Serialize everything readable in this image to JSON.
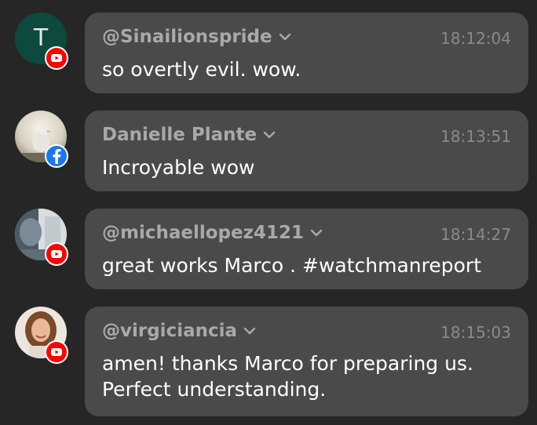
{
  "messages": [
    {
      "author": "@Sinailionspride",
      "time": "18:12:04",
      "text": "so overtly evil. wow.",
      "avatar_letter": "T",
      "platform": "youtube"
    },
    {
      "author": "Danielle Plante",
      "time": "18:13:51",
      "text": "Incroyable wow",
      "platform": "facebook"
    },
    {
      "author": "@michaellopez4121",
      "time": "18:14:27",
      "text": "great works Marco . #watchmanreport",
      "platform": "youtube"
    },
    {
      "author": "@virgiciancia",
      "time": "18:15:03",
      "text": "amen! thanks Marco for preparing us. Perfect understanding.",
      "platform": "youtube"
    }
  ],
  "colors": {
    "background": "#262626",
    "bubble": "#4a4a4a",
    "youtube": "#ff0000",
    "facebook": "#1877f2"
  }
}
